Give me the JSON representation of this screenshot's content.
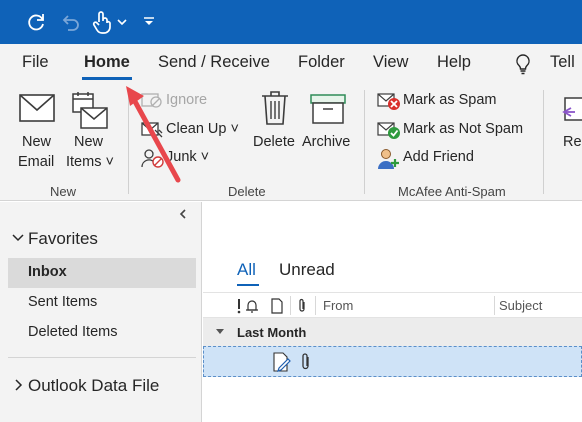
{
  "tabs": [
    {
      "label": "File"
    },
    {
      "label": "Home",
      "active": true
    },
    {
      "label": "Send / Receive"
    },
    {
      "label": "Folder"
    },
    {
      "label": "View"
    },
    {
      "label": "Help"
    },
    {
      "label": "Tell"
    }
  ],
  "ribbon": {
    "new_group": {
      "label": "New",
      "new_email": [
        "New",
        "Email"
      ],
      "new_items": [
        "New",
        "Items ˅"
      ]
    },
    "delete_group": {
      "label": "Delete",
      "ignore": "Ignore",
      "clean_up": "Clean Up ˅",
      "junk": "Junk ˅",
      "delete": "Delete",
      "archive": "Archive"
    },
    "mcafee_group": {
      "label": "McAfee Anti-Spam",
      "mark_spam": "Mark as Spam",
      "mark_not_spam": "Mark as Not Spam",
      "add_friend": "Add Friend"
    },
    "cut_off_label": "Re"
  },
  "folder_pane": {
    "favorites": "Favorites",
    "items": [
      "Inbox",
      "Sent Items",
      "Deleted Items"
    ],
    "data_file": "Outlook Data File"
  },
  "message_list": {
    "filters": {
      "all": "All",
      "unread": "Unread"
    },
    "columns": {
      "from": "From",
      "subject": "Subject"
    },
    "group_header": "Last Month"
  },
  "colors": {
    "title_bar": "#0f62b8",
    "accent": "#0f62b8",
    "annotation_arrow": "#e8474c"
  },
  "icons": [
    "refresh-icon",
    "undo-icon",
    "touch-mode-icon",
    "customize-qat-icon",
    "lightbulb-icon",
    "collapse-pane-icon",
    "chevron-down-icon",
    "chevron-right-icon",
    "attachment-icon",
    "edit-icon"
  ]
}
